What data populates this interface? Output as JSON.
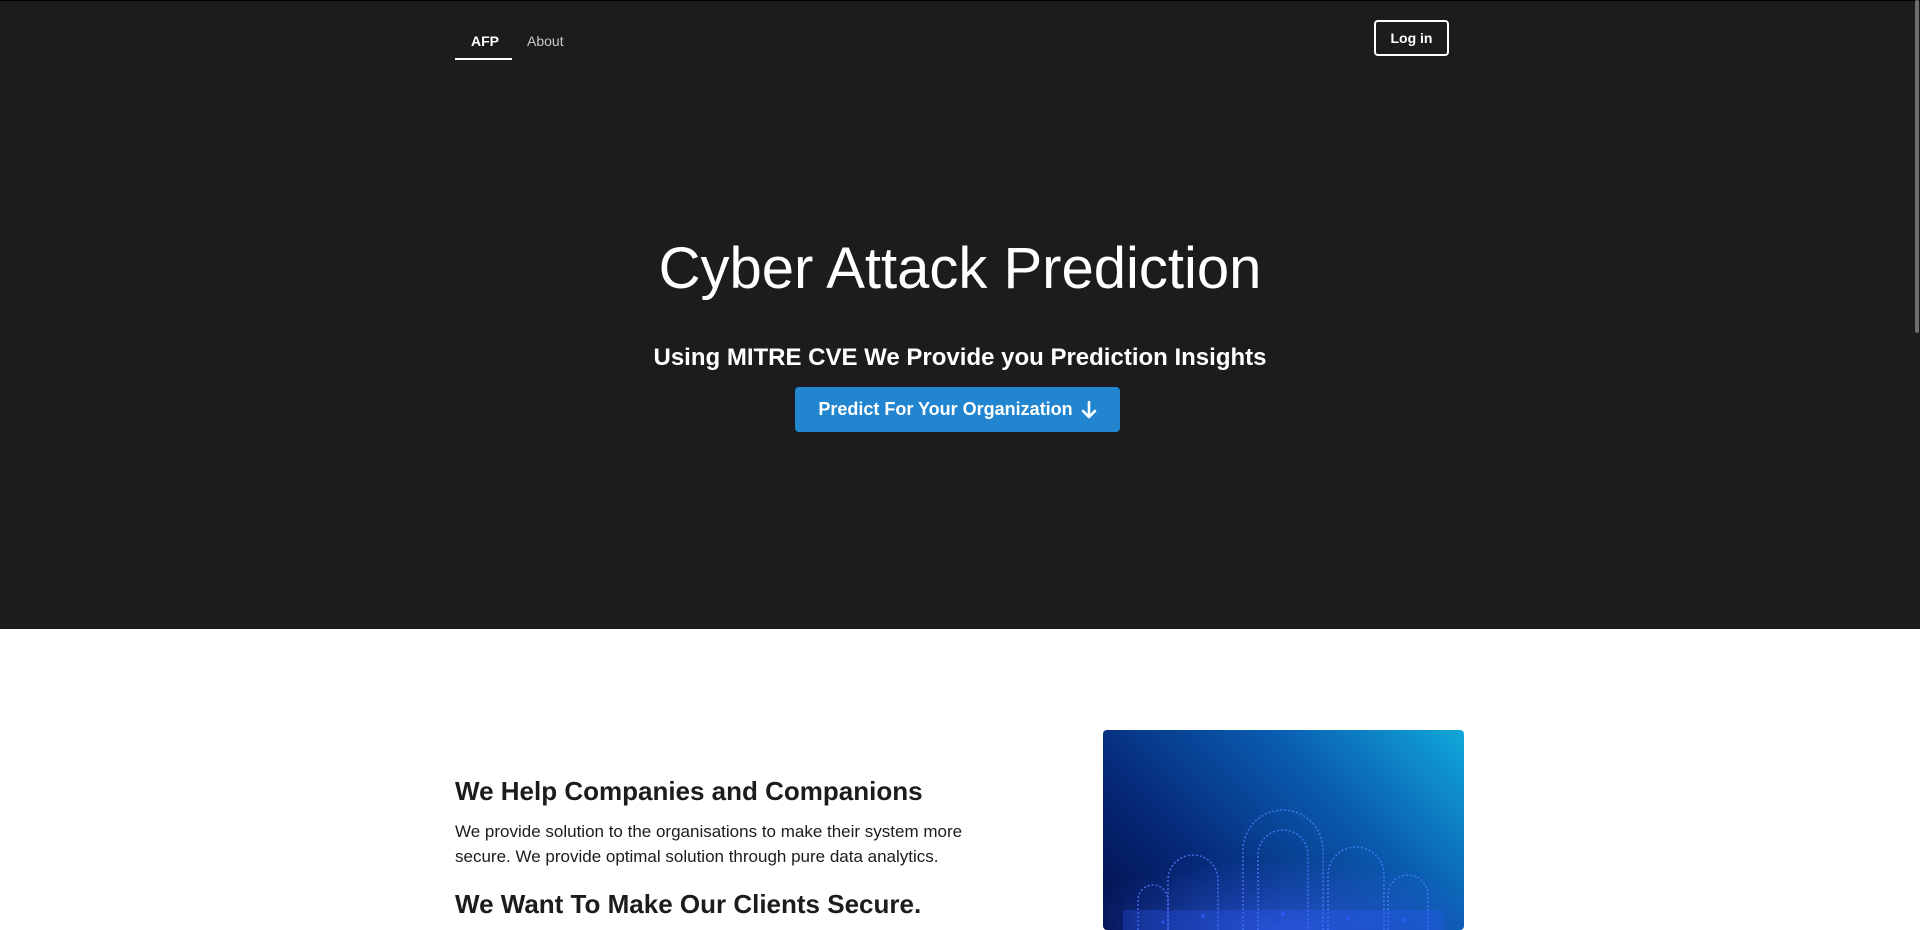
{
  "nav": {
    "items": [
      {
        "label": "AFP",
        "active": true
      },
      {
        "label": "About",
        "active": false
      }
    ],
    "login_label": "Log in"
  },
  "hero": {
    "title": "Cyber Attack Prediction",
    "subtitle": "Using MITRE CVE We Provide you Prediction Insights",
    "cta_label": "Predict For Your Organization",
    "cta_icon": "arrow-down-icon",
    "cta_color": "#2185d0",
    "background_color": "#1b1c1d"
  },
  "section": {
    "heading_1": "We Help Companies and Companions",
    "paragraph_1": "We provide solution to the organisations to make their system more secure. We provide optimal solution through pure data analytics.",
    "heading_2": "We Want To Make Our Clients Secure.",
    "image_icon": "padlock-network-icon"
  }
}
